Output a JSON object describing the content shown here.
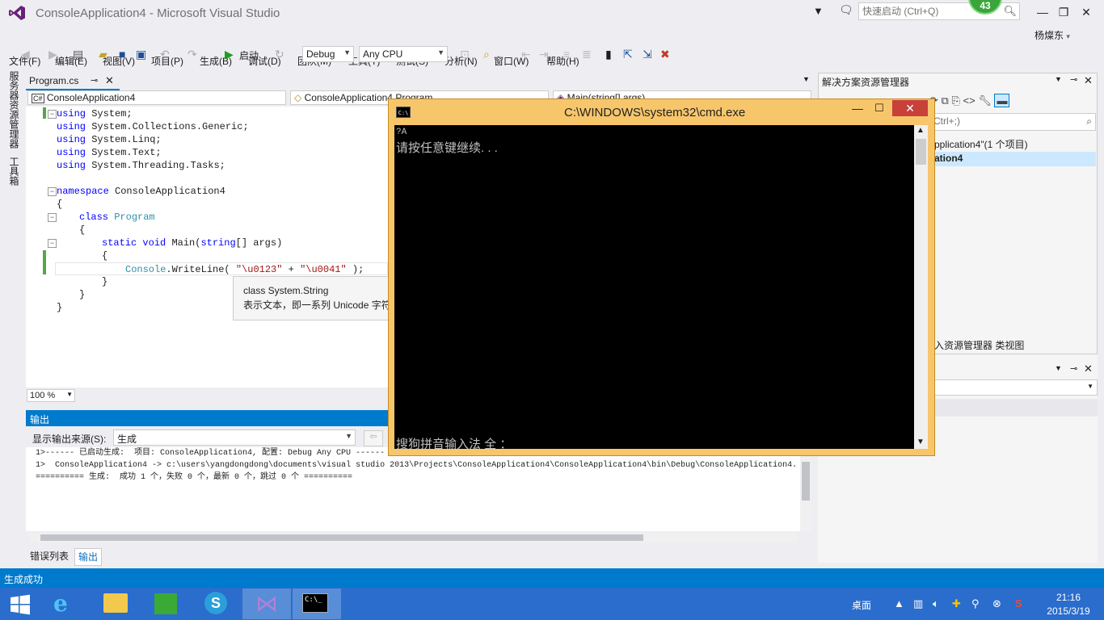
{
  "window": {
    "title": "ConsoleApplication4 - Microsoft Visual Studio",
    "quick_launch_placeholder": "快速启动 (Ctrl+Q)",
    "notification_count": "43",
    "user": "杨燦东"
  },
  "menu": [
    "文件(F)",
    "编辑(E)",
    "视图(V)",
    "项目(P)",
    "生成(B)",
    "调试(D)",
    "团队(M)",
    "工具(T)",
    "测试(S)",
    "分析(N)",
    "窗口(W)",
    "帮助(H)"
  ],
  "toolbar": {
    "start_label": "启动",
    "config": "Debug",
    "platform": "Any CPU"
  },
  "left_strip": [
    "服务器资源管理器",
    "工具箱"
  ],
  "editor": {
    "tab_label": "Program.cs",
    "nav_project": "ConsoleApplication4",
    "nav_class": "ConsoleApplication4.Program",
    "nav_member": "Main(string[] args)",
    "zoom": "100 %",
    "tooltip_line1": "class System.String",
    "tooltip_line2": "表示文本，即一系列 Unicode 字符。",
    "code": {
      "l1_kw": "using",
      "l1_rest": " System;",
      "l2_kw": "using",
      "l2_rest": " System.Collections.Generic;",
      "l3_kw": "using",
      "l3_rest": " System.Linq;",
      "l4_kw": "using",
      "l4_rest": " System.Text;",
      "l5_kw": "using",
      "l5_rest": " System.Threading.Tasks;",
      "l7_kw": "namespace",
      "l7_rest": " ConsoleApplication4",
      "l8": "{",
      "l9_kw": "class",
      "l9_ty": "Program",
      "l10": "{",
      "l11_kw1": "static",
      "l11_kw2": "void",
      "l11_name": "Main(",
      "l11_kw3": "string",
      "l11_rest": "[] args)",
      "l12": "{",
      "l13_ty": "Console",
      "l13_mid": ".WriteLine( ",
      "l13_s1": "\"\\u0123\"",
      "l13_plus": " + ",
      "l13_s2": "\"\\u0041\"",
      "l13_end": " );",
      "l14": "}",
      "l15": "}",
      "l16": "}"
    }
  },
  "output": {
    "title": "输出",
    "source_label": "显示输出来源(S):",
    "source_value": "生成",
    "line1": "1>------ 已启动生成:  项目: ConsoleApplication4, 配置: Debug Any CPU ------",
    "line2": "1>  ConsoleApplication4 -> c:\\users\\yangdongdong\\documents\\visual studio 2013\\Projects\\ConsoleApplication4\\ConsoleApplication4\\bin\\Debug\\ConsoleApplication4.",
    "line3": "========== 生成:  成功 1 个，失败 0 个，最新 0 个，跳过 0 个 ==========",
    "tab_errors": "错误列表",
    "tab_output": "输出"
  },
  "solution": {
    "title": "解决方案资源管理器",
    "search_placeholder": "Ctrl+;)",
    "item1": "pplication4\"(1 个项目)",
    "item2": "ation4",
    "bottom_tab1": "入资源管理器",
    "bottom_tab2": "类视图"
  },
  "cmd": {
    "title": "C:\\WINDOWS\\system32\\cmd.exe",
    "icon_text": "C:\\",
    "line1": "?A",
    "line2": "请按任意键继续. . .",
    "ime": "搜狗拼音输入法 全 ："
  },
  "status": {
    "text": "生成成功"
  },
  "taskbar": {
    "desktop": "桌面",
    "time": "21:16",
    "date": "2015/3/19"
  }
}
